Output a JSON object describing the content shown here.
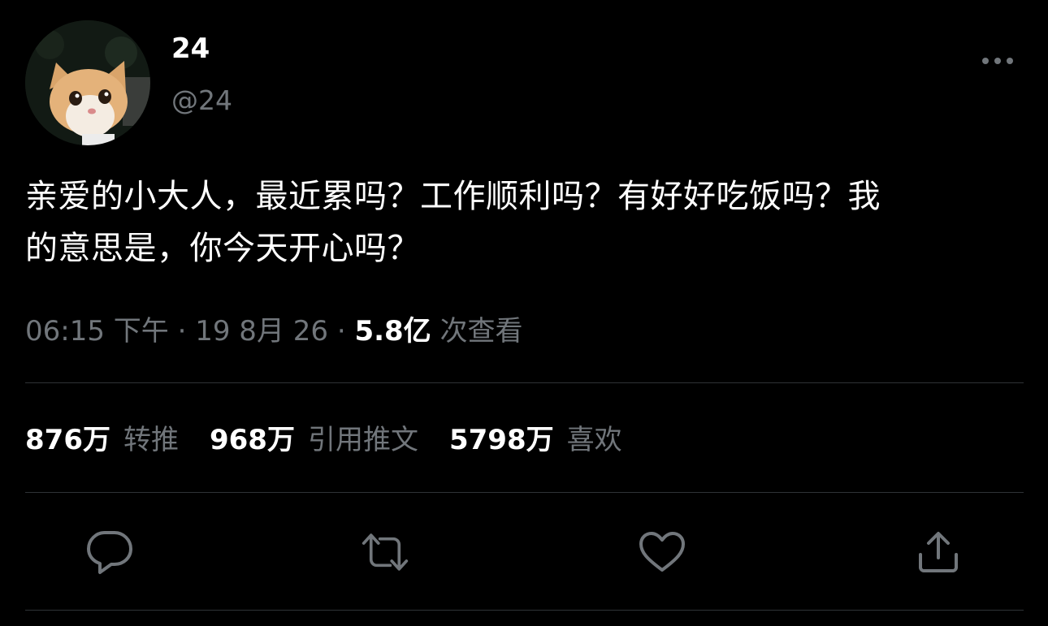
{
  "user": {
    "display_name": "24",
    "handle": "@24",
    "avatar_icon": "cat-avatar"
  },
  "tweet": {
    "text": "亲爱的小大人，最近累吗？工作顺利吗？有好好吃饭吗？我\n的意思是，你今天开心吗？",
    "time": "06:15 下午",
    "date": "19 8月 26",
    "views_count": "5.8亿",
    "views_label": "次查看"
  },
  "stats": {
    "retweets": {
      "count": "876万",
      "label": "转推"
    },
    "quotes": {
      "count": "968万",
      "label": "引用推文"
    },
    "likes": {
      "count": "5798万",
      "label": "喜欢"
    }
  },
  "actions": {
    "reply_icon": "reply-icon",
    "retweet_icon": "retweet-icon",
    "like_icon": "heart-icon",
    "share_icon": "share-icon",
    "more_icon": "more-icon"
  },
  "colors": {
    "background": "#000000",
    "primary_text": "#ffffff",
    "secondary_text": "#71767b",
    "divider": "#2f3336"
  }
}
